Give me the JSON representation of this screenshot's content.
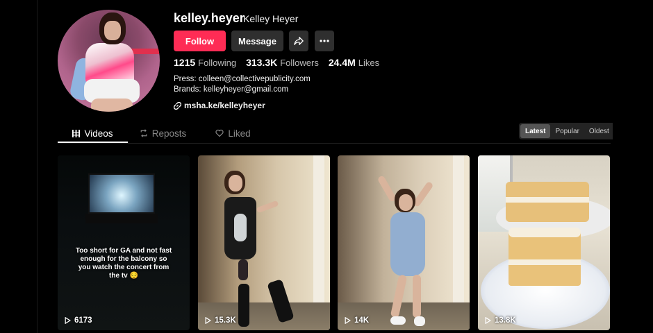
{
  "profile": {
    "username": "kelley.heyer",
    "display_name": "Kelley Heyer",
    "follow_label": "Follow",
    "message_label": "Message",
    "stats": {
      "following": "1215",
      "following_label": "Following",
      "followers": "313.3K",
      "followers_label": "Followers",
      "likes": "24.4M",
      "likes_label": "Likes"
    },
    "bio_line1": "Press: colleen@collectivepublicity.com",
    "bio_line2": "Brands: kelleyheyer@gmail.com",
    "link": "msha.ke/kelleyheyer"
  },
  "tabs": [
    {
      "label": "Videos",
      "icon": "grid-icon",
      "active": true
    },
    {
      "label": "Reposts",
      "icon": "repost-icon",
      "active": false
    },
    {
      "label": "Liked",
      "icon": "heart-icon",
      "active": false
    }
  ],
  "sort": {
    "options": [
      "Latest",
      "Popular",
      "Oldest"
    ],
    "selected": "Latest"
  },
  "videos": [
    {
      "views": "6173",
      "caption": "Too short for GA and not fast enough for the balcony so you watch the concert from the tv 😔"
    },
    {
      "views": "15.3K"
    },
    {
      "views": "14K"
    },
    {
      "views": "13.8K"
    }
  ],
  "colors": {
    "accent": "#fe2c55",
    "background": "#000000",
    "button_secondary": "#2f2f2f"
  }
}
